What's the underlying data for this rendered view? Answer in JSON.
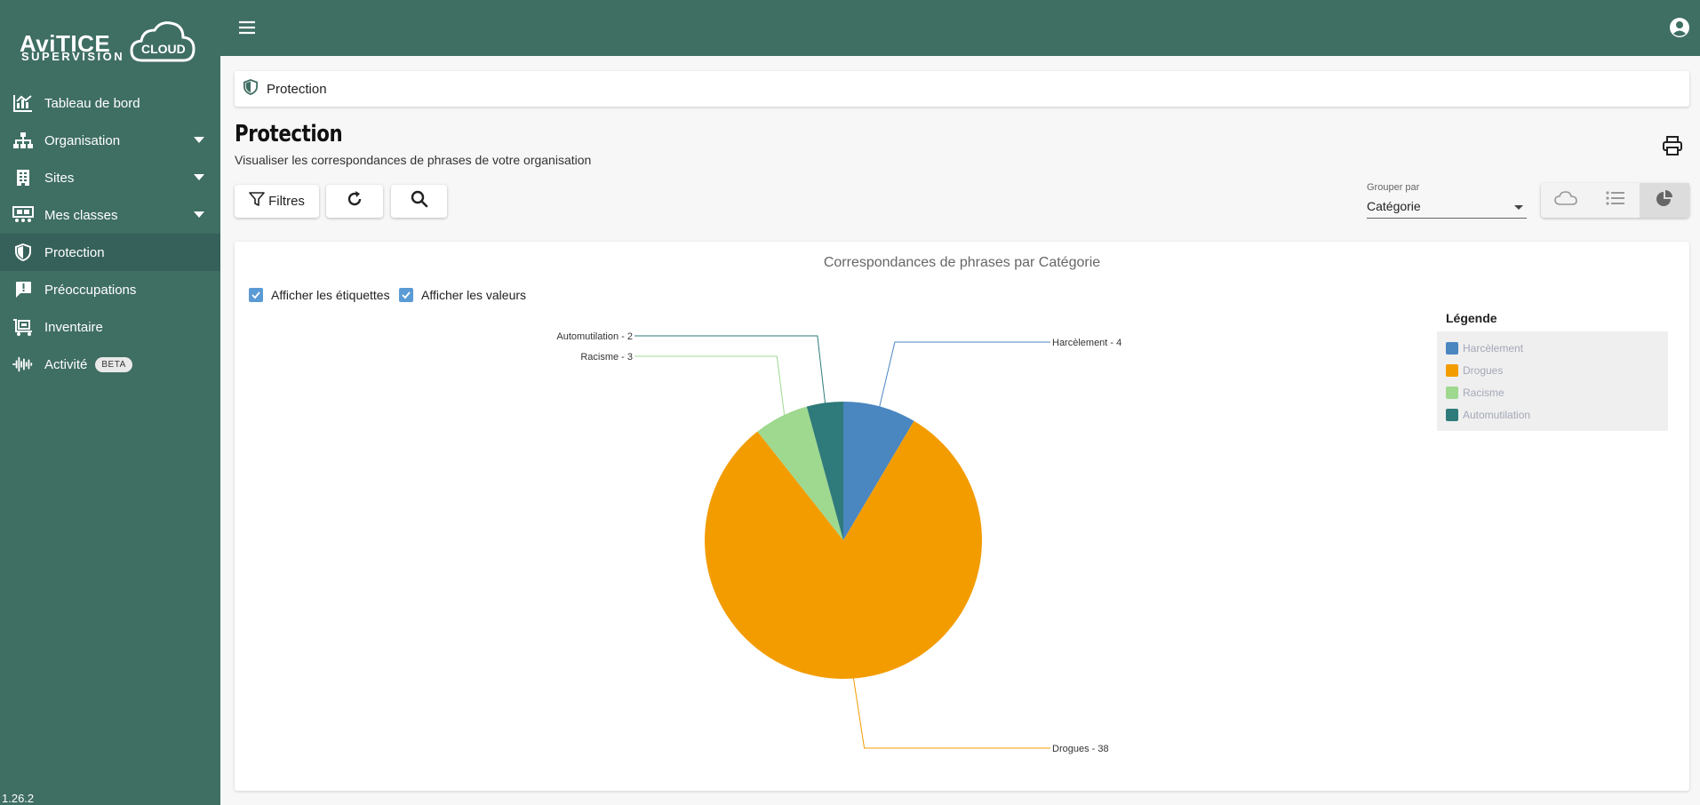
{
  "app": {
    "logo_main": "AviTICE",
    "logo_sub": "SUPERVISION",
    "logo_cloud": "CLOUD",
    "version": "1.26.2"
  },
  "sidebar": {
    "items": [
      {
        "label": "Tableau de bord",
        "icon": "chart-icon"
      },
      {
        "label": "Organisation",
        "icon": "sitemap-icon"
      },
      {
        "label": "Sites",
        "icon": "building-icon"
      },
      {
        "label": "Mes classes",
        "icon": "classroom-icon"
      },
      {
        "label": "Protection",
        "icon": "shield-icon"
      },
      {
        "label": "Préoccupations",
        "icon": "alert-icon"
      },
      {
        "label": "Inventaire",
        "icon": "inventory-icon"
      },
      {
        "label": "Activité",
        "icon": "waveform-icon",
        "badge": "BETA"
      }
    ]
  },
  "breadcrumb": {
    "label": "Protection"
  },
  "page": {
    "title": "Protection",
    "subtitle": "Visualiser les correspondances de phrases de votre organisation"
  },
  "toolbar": {
    "filter_label": "Filtres",
    "group_by_label": "Grouper par",
    "group_by_value": "Catégorie"
  },
  "chart_options": {
    "show_labels": "Afficher les étiquettes",
    "show_values": "Afficher les valeurs"
  },
  "chart_data": {
    "type": "pie",
    "title": "Correspondances de phrases par Catégorie",
    "legend_title": "Légende",
    "legend_position": "right",
    "slices": [
      {
        "label": "Harcèlement",
        "value": 4,
        "color": "#4a86c0"
      },
      {
        "label": "Drogues",
        "value": 38,
        "color": "#f39c00"
      },
      {
        "label": "Racisme",
        "value": 3,
        "color": "#9fd88f"
      },
      {
        "label": "Automutilation",
        "value": 2,
        "color": "#2f7a7a"
      }
    ]
  },
  "colors": {
    "sidebar_bg": "#3f6e63",
    "active_item_bg": "#36615a",
    "checkbox": "#5b9bd5"
  }
}
